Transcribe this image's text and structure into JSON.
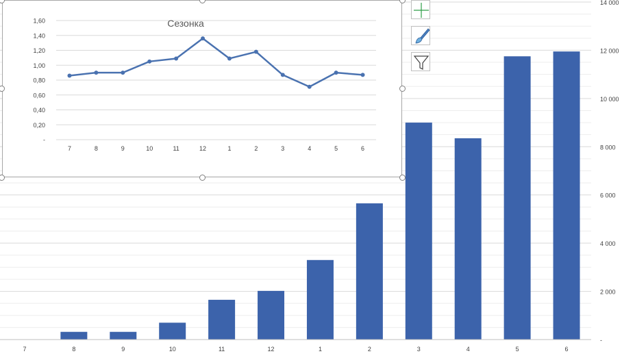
{
  "chart_data": [
    {
      "type": "bar",
      "categories": [
        "7",
        "8",
        "9",
        "10",
        "11",
        "12",
        "1",
        "2",
        "3",
        "4",
        "5",
        "6"
      ],
      "values": [
        0,
        320,
        320,
        700,
        1650,
        2020,
        3300,
        5650,
        9000,
        8350,
        11750,
        11950
      ],
      "yticks": [
        "-",
        "2 000",
        "4 000",
        "6 000",
        "8 000",
        "10 000",
        "12 000",
        "14 000"
      ],
      "ylim": [
        0,
        14000
      ],
      "color": "#3c63ab",
      "grid": true,
      "title": ""
    },
    {
      "type": "line",
      "title": "Сезонка",
      "categories": [
        "7",
        "8",
        "9",
        "10",
        "11",
        "12",
        "1",
        "2",
        "3",
        "4",
        "5",
        "6"
      ],
      "values": [
        0.86,
        0.9,
        0.9,
        1.05,
        1.09,
        1.36,
        1.09,
        1.18,
        0.87,
        0.71,
        0.9,
        0.87
      ],
      "yticks": [
        "-",
        "0,20",
        "0,40",
        "0,60",
        "0,80",
        "1,00",
        "1,20",
        "1,40",
        "1,60"
      ],
      "ylim": [
        0,
        1.6
      ],
      "color": "#4a72b0",
      "grid": true
    }
  ],
  "toolbar": {
    "icons": [
      "plus-icon",
      "brush-icon",
      "filter-icon"
    ]
  }
}
